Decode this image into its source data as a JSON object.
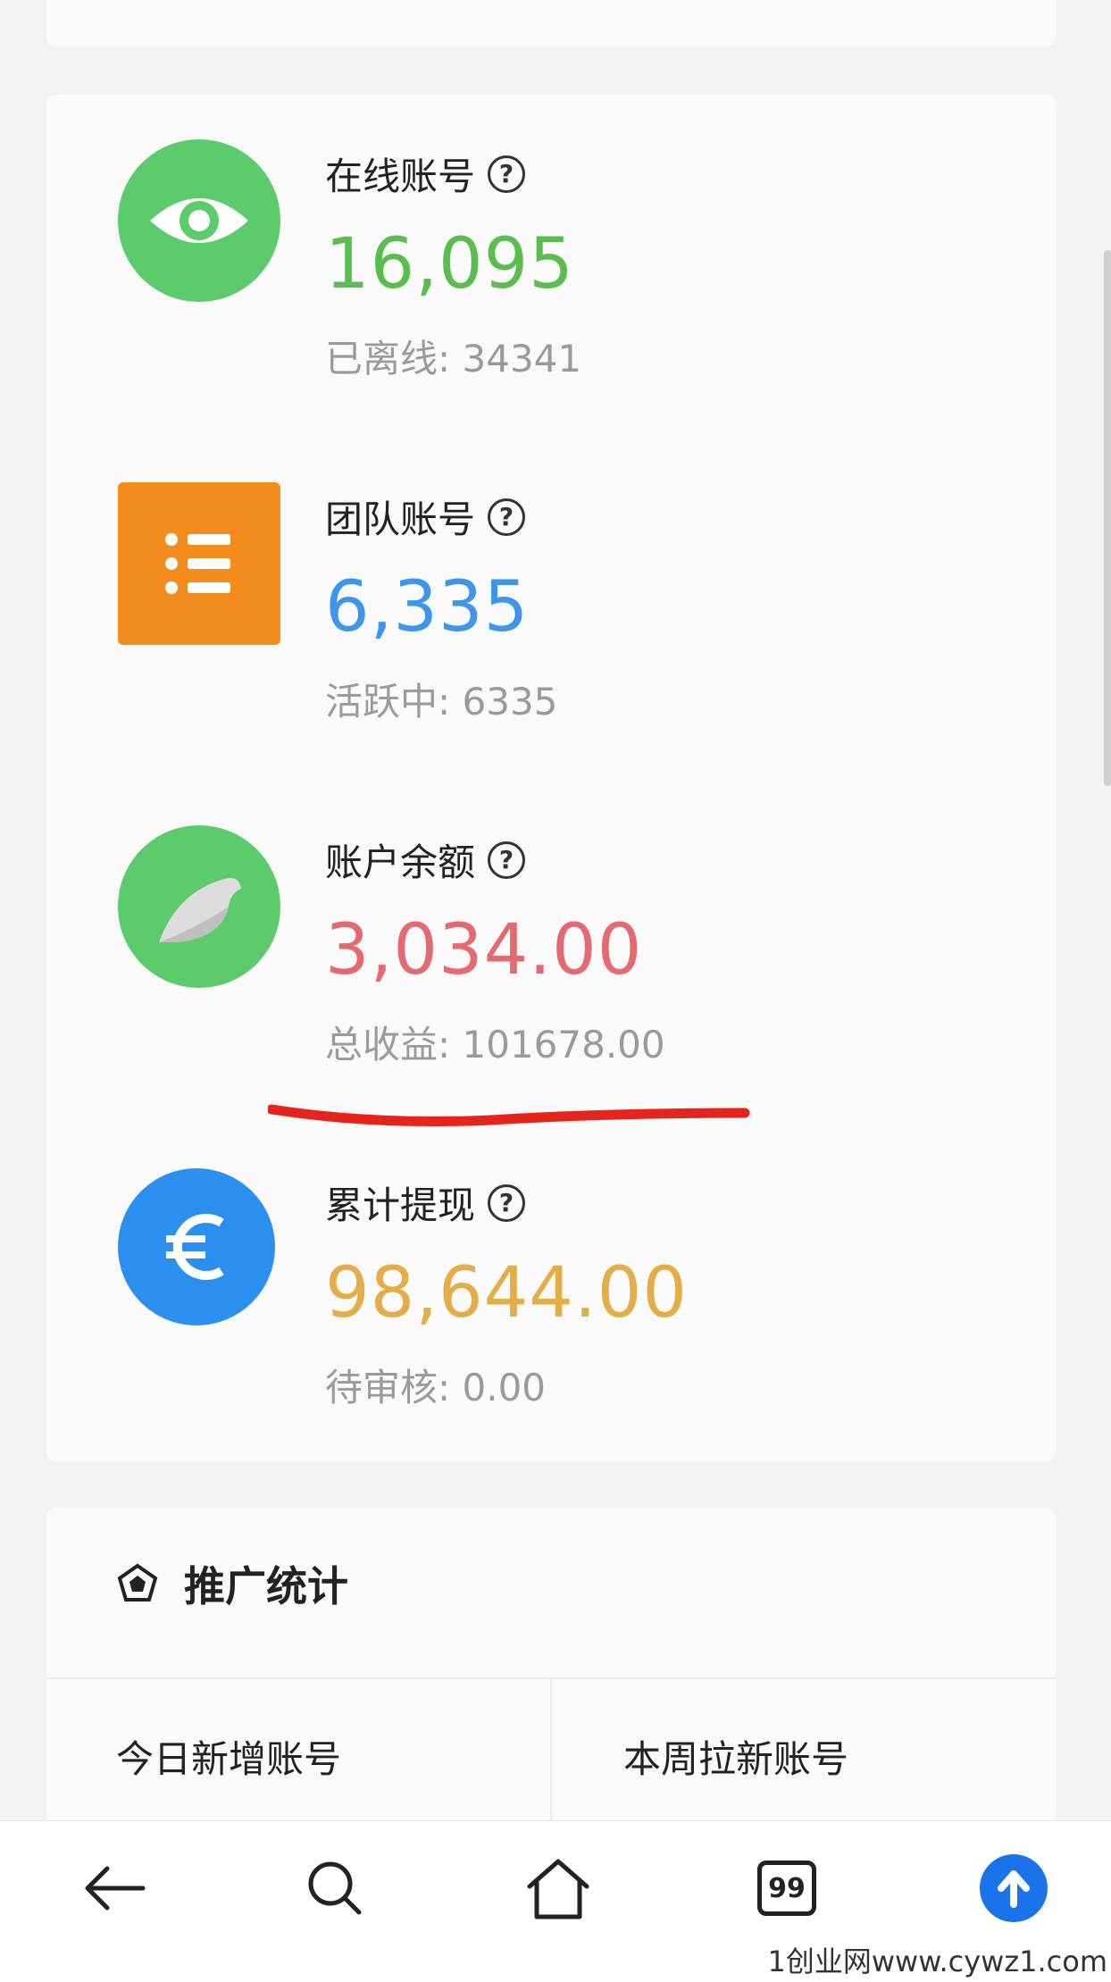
{
  "stats": [
    {
      "label": "在线账号",
      "value": "16,095",
      "sub": "已离线: 34341",
      "icon": "eye-icon",
      "color": "#5bbc4f"
    },
    {
      "label": "团队账号",
      "value": "6,335",
      "sub": "活跃中: 6335",
      "icon": "list-icon",
      "color": "#3f95e8"
    },
    {
      "label": "账户余额",
      "value": "3,034.00",
      "sub": "总收益: 101678.00",
      "icon": "bird-icon",
      "color": "#e36a6f"
    },
    {
      "label": "累计提现",
      "value": "98,644.00",
      "sub": "待审核: 0.00",
      "icon": "euro-icon",
      "color": "#e3ad47"
    }
  ],
  "help_glyph": "?",
  "promo": {
    "title": "推广统计",
    "cells": [
      "今日新增账号",
      "本周拉新账号"
    ]
  },
  "bottom_nav": {
    "tabs_badge": "99",
    "icons": [
      "back-arrow-icon",
      "search-icon",
      "home-icon",
      "tabs-icon",
      "upload-icon"
    ]
  },
  "watermark": "1创业网www.cywz1.com",
  "annotation_color": "#e5251c"
}
